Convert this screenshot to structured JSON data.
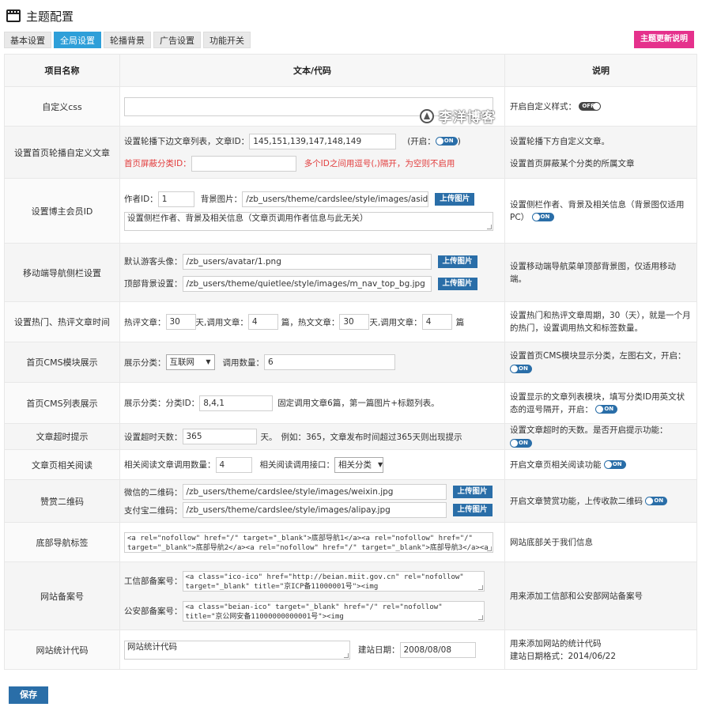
{
  "header": {
    "title": "主题配置"
  },
  "tabs": [
    "基本设置",
    "全局设置",
    "轮播背景",
    "广告设置",
    "功能开关"
  ],
  "active_tab": "全局设置",
  "update_button": "主题更新说明",
  "columns": {
    "name": "项目名称",
    "content": "文本/代码",
    "desc": "说明"
  },
  "watermark": "李洋博客",
  "toggles": {
    "on": "ON",
    "off": "OFF"
  },
  "upload_label": "上传图片",
  "rows": {
    "css": {
      "name": "自定义css",
      "value": "",
      "desc": "开启自定义样式："
    },
    "slider": {
      "name": "设置首页轮播自定义文章",
      "l1_label": "设置轮播下边文章列表，文章ID：",
      "l1_value": "145,151,139,147,148,149",
      "l1_open": "(开启：",
      "l1_close": ")",
      "l2_label": "首页屏蔽分类ID：",
      "l2_value": "",
      "l2_hint": "多个ID之间用逗号(,)隔开，为空则不启用",
      "desc1": "设置轮播下方自定义文章。",
      "desc2": "设置首页屏蔽某个分类的所属文章"
    },
    "owner": {
      "name": "设置博主会员ID",
      "author_label": "作者ID：",
      "author_value": "1",
      "bg_label": "背景图片：",
      "bg_value": "/zb_users/theme/cardslee/style/images/aside-author",
      "info_value": "设置侧栏作者、背景及相关信息（文章页调用作者信息与此无关）",
      "desc": "设置侧栏作者、背景及相关信息（背景图仅适用PC）"
    },
    "mobile": {
      "name": "移动端导航侧栏设置",
      "avatar_label": "默认游客头像：",
      "avatar_value": "/zb_users/avatar/1.png",
      "topbg_label": "顶部背景设置：",
      "topbg_value": "/zb_users/theme/quietlee/style/images/m_nav_top_bg.jpg",
      "desc": "设置移动端导航菜单顶部背景图，仅适用移动端。"
    },
    "hot": {
      "name": "设置热门、热评文章时间",
      "hc_label": "热评文章：",
      "hc_days": "30",
      "days_call": "天,调用文章：",
      "hc_count": "4",
      "pian_hot": "篇，热文文章：",
      "hot_days": "30",
      "hot_count": "4",
      "pian": "篇",
      "desc": "设置热门和热评文章周期，30（天），就是一个月的热门，设置调用热文和标签数量。"
    },
    "cms_module": {
      "name": "首页CMS模块展示",
      "cat_label": "展示分类：",
      "cat_value": "互联网",
      "count_label": "调用数量：",
      "count_value": "6",
      "desc": "设置首页CMS模块显示分类，左图右文，开启："
    },
    "cms_list": {
      "name": "首页CMS列表展示",
      "label": "展示分类：分类ID：",
      "value": "8,4,1",
      "hint": "固定调用文章6篇，第一篇图片+标题列表。",
      "desc": "设置显示的文章列表模块，填写分类ID用英文状态的逗号隔开，开启："
    },
    "timeout": {
      "name": "文章超时提示",
      "label": "设置超时天数：",
      "value": "365",
      "unit": "天。",
      "hint": "例如：365，文章发布时间超过365天则出现提示",
      "desc": "设置文章超时的天数。是否开启提示功能："
    },
    "related": {
      "name": "文章页相关阅读",
      "label": "相关阅读文章调用数量：",
      "value": "4",
      "api_label": "相关阅读调用接口：",
      "api_value": "相关分类",
      "desc": "开启文章页相关阅读功能"
    },
    "qrcode": {
      "name": "赞赏二维码",
      "wx_label": "微信的二维码：",
      "wx_value": "/zb_users/theme/cardslee/style/images/weixin.jpg",
      "ali_label": "支付宝二维码：",
      "ali_value": "/zb_users/theme/cardslee/style/images/alipay.jpg",
      "desc": "开启文章赞赏功能，上传收款二维码"
    },
    "footer_nav": {
      "name": "底部导航标签",
      "value": "<a rel=\"nofollow\" href=\"/\" target=\"_blank\">底部导航1</a><a rel=\"nofollow\" href=\"/\" target=\"_blank\">底部导航2</a><a rel=\"nofollow\" href=\"/\" target=\"_blank\">底部导航3</a><a",
      "desc": "网站底部关于我们信息"
    },
    "beian": {
      "name": "网站备案号",
      "icp_label": "工信部备案号：",
      "icp_value": "<a class=\"ico-ico\" href=\"http://beian.miit.gov.cn\" rel=\"nofollow\" target=\"_blank\" title=\"京ICP备11000001号\"><img",
      "police_label": "公安部备案号：",
      "police_value": "<a class=\"beian-ico\" target=\"_blank\" href=\"/\" rel=\"nofollow\" title=\"京公网安备11000000000001号\"><img",
      "desc": "用来添加工信部和公安部网站备案号"
    },
    "stats": {
      "name": "网站统计代码",
      "value": "网站统计代码",
      "date_label": "建站日期：",
      "date_value": "2008/08/08",
      "desc1": "用来添加网站的统计代码",
      "desc2": "建站日期格式：2014/06/22"
    }
  },
  "save_button": "保存"
}
